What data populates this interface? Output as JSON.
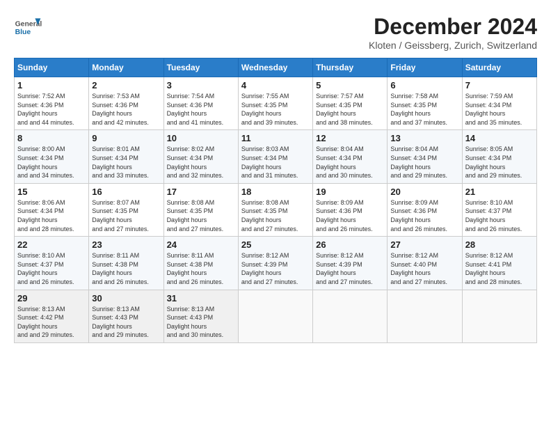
{
  "logo": {
    "text_general": "General",
    "text_blue": "Blue"
  },
  "title": {
    "month": "December 2024",
    "location": "Kloten / Geissberg, Zurich, Switzerland"
  },
  "weekdays": [
    "Sunday",
    "Monday",
    "Tuesday",
    "Wednesday",
    "Thursday",
    "Friday",
    "Saturday"
  ],
  "weeks": [
    [
      {
        "day": "1",
        "sunrise": "7:52 AM",
        "sunset": "4:36 PM",
        "daylight": "8 hours and 44 minutes."
      },
      {
        "day": "2",
        "sunrise": "7:53 AM",
        "sunset": "4:36 PM",
        "daylight": "8 hours and 42 minutes."
      },
      {
        "day": "3",
        "sunrise": "7:54 AM",
        "sunset": "4:36 PM",
        "daylight": "8 hours and 41 minutes."
      },
      {
        "day": "4",
        "sunrise": "7:55 AM",
        "sunset": "4:35 PM",
        "daylight": "8 hours and 39 minutes."
      },
      {
        "day": "5",
        "sunrise": "7:57 AM",
        "sunset": "4:35 PM",
        "daylight": "8 hours and 38 minutes."
      },
      {
        "day": "6",
        "sunrise": "7:58 AM",
        "sunset": "4:35 PM",
        "daylight": "8 hours and 37 minutes."
      },
      {
        "day": "7",
        "sunrise": "7:59 AM",
        "sunset": "4:34 PM",
        "daylight": "8 hours and 35 minutes."
      }
    ],
    [
      {
        "day": "8",
        "sunrise": "8:00 AM",
        "sunset": "4:34 PM",
        "daylight": "8 hours and 34 minutes."
      },
      {
        "day": "9",
        "sunrise": "8:01 AM",
        "sunset": "4:34 PM",
        "daylight": "8 hours and 33 minutes."
      },
      {
        "day": "10",
        "sunrise": "8:02 AM",
        "sunset": "4:34 PM",
        "daylight": "8 hours and 32 minutes."
      },
      {
        "day": "11",
        "sunrise": "8:03 AM",
        "sunset": "4:34 PM",
        "daylight": "8 hours and 31 minutes."
      },
      {
        "day": "12",
        "sunrise": "8:04 AM",
        "sunset": "4:34 PM",
        "daylight": "8 hours and 30 minutes."
      },
      {
        "day": "13",
        "sunrise": "8:04 AM",
        "sunset": "4:34 PM",
        "daylight": "8 hours and 29 minutes."
      },
      {
        "day": "14",
        "sunrise": "8:05 AM",
        "sunset": "4:34 PM",
        "daylight": "8 hours and 29 minutes."
      }
    ],
    [
      {
        "day": "15",
        "sunrise": "8:06 AM",
        "sunset": "4:34 PM",
        "daylight": "8 hours and 28 minutes."
      },
      {
        "day": "16",
        "sunrise": "8:07 AM",
        "sunset": "4:35 PM",
        "daylight": "8 hours and 27 minutes."
      },
      {
        "day": "17",
        "sunrise": "8:08 AM",
        "sunset": "4:35 PM",
        "daylight": "8 hours and 27 minutes."
      },
      {
        "day": "18",
        "sunrise": "8:08 AM",
        "sunset": "4:35 PM",
        "daylight": "8 hours and 27 minutes."
      },
      {
        "day": "19",
        "sunrise": "8:09 AM",
        "sunset": "4:36 PM",
        "daylight": "8 hours and 26 minutes."
      },
      {
        "day": "20",
        "sunrise": "8:09 AM",
        "sunset": "4:36 PM",
        "daylight": "8 hours and 26 minutes."
      },
      {
        "day": "21",
        "sunrise": "8:10 AM",
        "sunset": "4:37 PM",
        "daylight": "8 hours and 26 minutes."
      }
    ],
    [
      {
        "day": "22",
        "sunrise": "8:10 AM",
        "sunset": "4:37 PM",
        "daylight": "8 hours and 26 minutes."
      },
      {
        "day": "23",
        "sunrise": "8:11 AM",
        "sunset": "4:38 PM",
        "daylight": "8 hours and 26 minutes."
      },
      {
        "day": "24",
        "sunrise": "8:11 AM",
        "sunset": "4:38 PM",
        "daylight": "8 hours and 26 minutes."
      },
      {
        "day": "25",
        "sunrise": "8:12 AM",
        "sunset": "4:39 PM",
        "daylight": "8 hours and 27 minutes."
      },
      {
        "day": "26",
        "sunrise": "8:12 AM",
        "sunset": "4:39 PM",
        "daylight": "8 hours and 27 minutes."
      },
      {
        "day": "27",
        "sunrise": "8:12 AM",
        "sunset": "4:40 PM",
        "daylight": "8 hours and 27 minutes."
      },
      {
        "day": "28",
        "sunrise": "8:12 AM",
        "sunset": "4:41 PM",
        "daylight": "8 hours and 28 minutes."
      }
    ],
    [
      {
        "day": "29",
        "sunrise": "8:13 AM",
        "sunset": "4:42 PM",
        "daylight": "8 hours and 29 minutes."
      },
      {
        "day": "30",
        "sunrise": "8:13 AM",
        "sunset": "4:43 PM",
        "daylight": "8 hours and 29 minutes."
      },
      {
        "day": "31",
        "sunrise": "8:13 AM",
        "sunset": "4:43 PM",
        "daylight": "8 hours and 30 minutes."
      },
      null,
      null,
      null,
      null
    ]
  ]
}
